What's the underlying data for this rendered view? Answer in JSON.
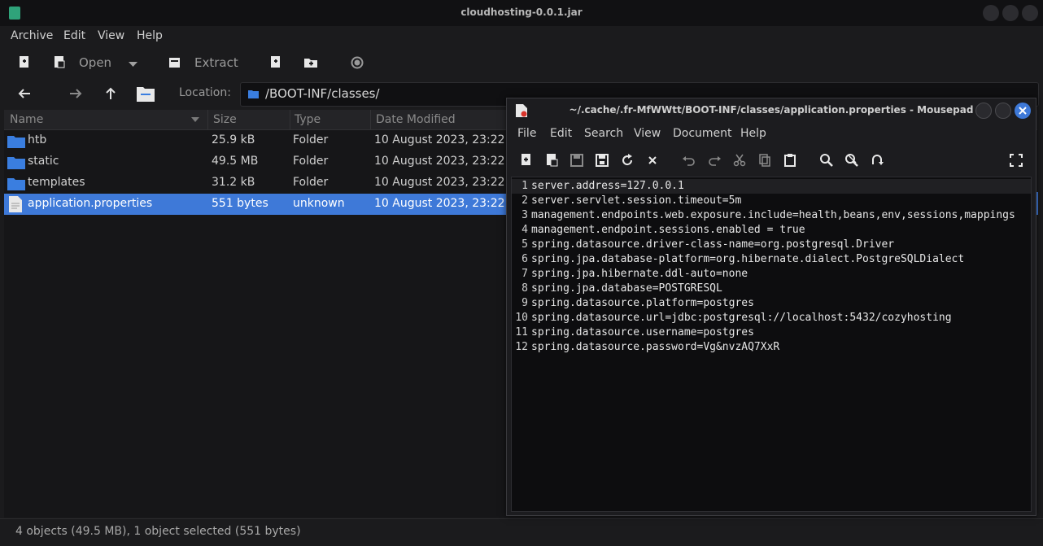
{
  "archive_window": {
    "title": "cloudhosting-0.0.1.jar",
    "menu": [
      "Archive",
      "Edit",
      "View",
      "Help"
    ],
    "toolbar": {
      "open_label": "Open",
      "extract_label": "Extract"
    },
    "location_label": "Location:",
    "location_path": "/BOOT-INF/classes/",
    "columns": [
      "Name",
      "Size",
      "Type",
      "Date Modified"
    ],
    "files": [
      {
        "name": "htb",
        "size": "25.9 kB",
        "type": "Folder",
        "date": "10 August 2023, 23:22",
        "icon": "folder-icon"
      },
      {
        "name": "static",
        "size": "49.5 MB",
        "type": "Folder",
        "date": "10 August 2023, 23:22",
        "icon": "folder-icon"
      },
      {
        "name": "templates",
        "size": "31.2 kB",
        "type": "Folder",
        "date": "10 August 2023, 23:22",
        "icon": "folder-icon"
      },
      {
        "name": "application.properties",
        "size": "551 bytes",
        "type": "unknown",
        "date": "10 August 2023, 23:22",
        "icon": "text-file-icon"
      }
    ],
    "status": "4 objects (49.5 MB), 1 object selected (551 bytes)"
  },
  "editor_window": {
    "title": "~/.cache/.fr-MfWWtt/BOOT-INF/classes/application.properties - Mousepad",
    "menu": [
      "File",
      "Edit",
      "Search",
      "View",
      "Document",
      "Help"
    ],
    "lines": [
      "server.address=127.0.0.1",
      "server.servlet.session.timeout=5m",
      "management.endpoints.web.exposure.include=health,beans,env,sessions,mappings",
      "management.endpoint.sessions.enabled = true",
      "spring.datasource.driver-class-name=org.postgresql.Driver",
      "spring.jpa.database-platform=org.hibernate.dialect.PostgreSQLDialect",
      "spring.jpa.hibernate.ddl-auto=none",
      "spring.jpa.database=POSTGRESQL",
      "spring.datasource.platform=postgres",
      "spring.datasource.url=jdbc:postgresql://localhost:5432/cozyhosting",
      "spring.datasource.username=postgres",
      "spring.datasource.password=Vg&nvzAQ7XxR"
    ]
  },
  "colors": {
    "selection": "#3e79d8",
    "close_button": "#3e79d8",
    "folder": "#3a7ee0"
  }
}
